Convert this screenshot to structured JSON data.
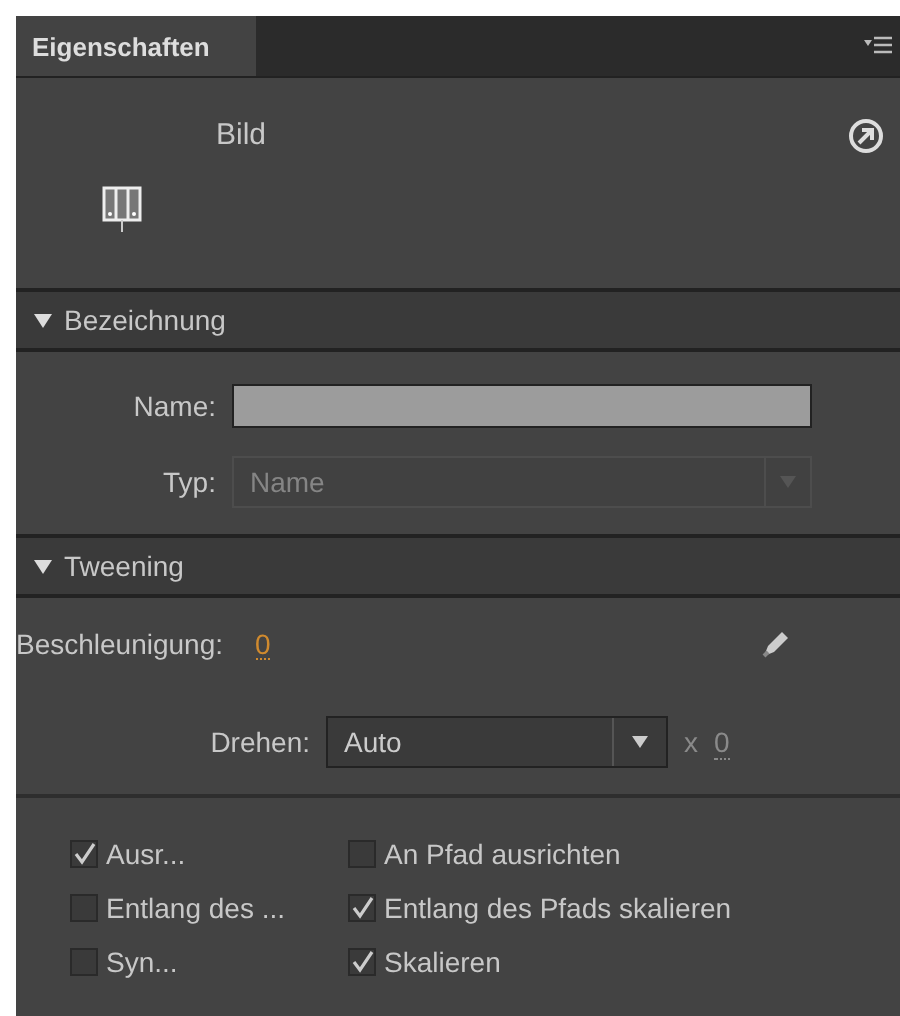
{
  "tab": {
    "label": "Eigenschaften",
    "selected": true
  },
  "symbol": {
    "name": "Bild"
  },
  "sections": [
    {
      "title": "Bezeichnung",
      "expanded": true
    },
    {
      "title": "Tweening",
      "expanded": true
    }
  ],
  "name_field": {
    "label": "Name:"
  },
  "type_field": {
    "label": "Typ:",
    "value": "Name",
    "disabled": true
  },
  "easing": {
    "label": "Beschleunigung:",
    "value": "0"
  },
  "rotate": {
    "label": "Drehen:",
    "value": "Auto",
    "times": "x",
    "count": "0",
    "count_disabled": true
  },
  "options": [
    {
      "label": "Ausr...",
      "checked": true
    },
    {
      "label": "An Pfad ausrichten",
      "checked": false
    },
    {
      "label": "Entlang des ...",
      "checked": false
    },
    {
      "label": "Entlang des Pfads skalieren",
      "checked": true
    },
    {
      "label": "Syn...",
      "checked": false
    },
    {
      "label": "Skalieren",
      "checked": true
    }
  ]
}
